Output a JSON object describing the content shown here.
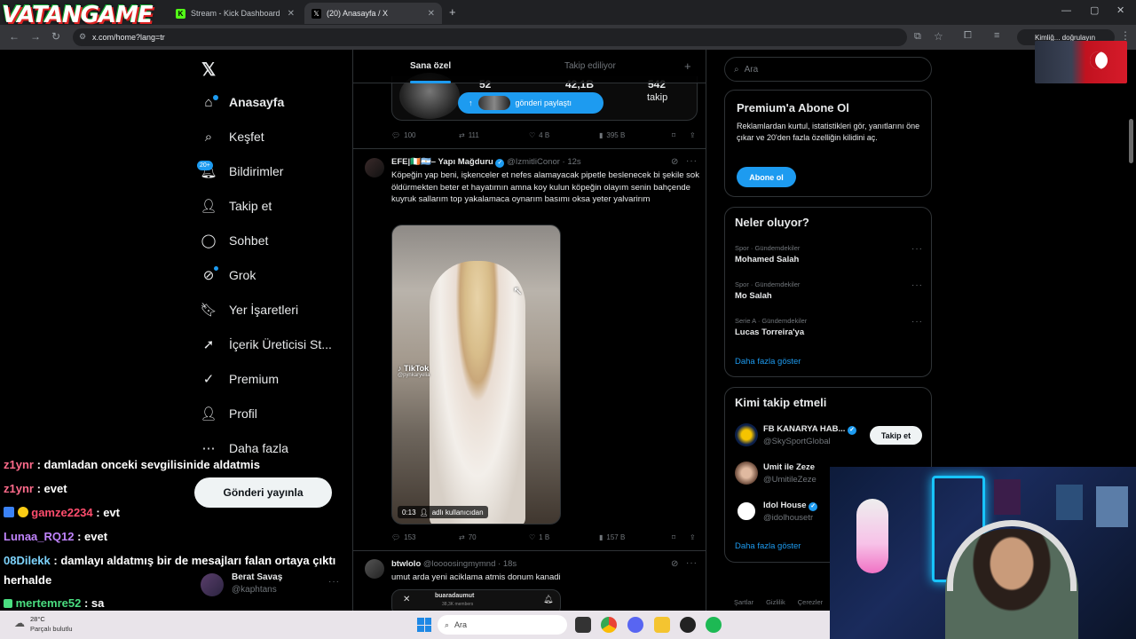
{
  "browser": {
    "tabs": [
      {
        "label": "Stream - Kick Dashboard"
      },
      {
        "label": "(20) Anasayfa / X"
      }
    ],
    "url": "x.com/home?lang=tr",
    "profile_label": "Kimliğ... doğrulayın",
    "watermark": "VATANGAME"
  },
  "sidebar": {
    "items": [
      {
        "label": "Anasayfa"
      },
      {
        "label": "Keşfet"
      },
      {
        "label": "Bildirimler",
        "badge": "20+"
      },
      {
        "label": "Takip et"
      },
      {
        "label": "Sohbet"
      },
      {
        "label": "Grok"
      },
      {
        "label": "Yer İşaretleri"
      },
      {
        "label": "İçerik Üreticisi St..."
      },
      {
        "label": "Premium"
      },
      {
        "label": "Profil"
      },
      {
        "label": "Daha fazla"
      }
    ],
    "post_button": "Gönderi yayınla",
    "account": {
      "name": "Berat Savaş",
      "handle": "@kaphtans"
    }
  },
  "feed": {
    "tabs": [
      "Sana özel",
      "Takip ediliyor"
    ],
    "embed": {
      "stat1": "52",
      "stat2": "42,1B",
      "stat3": "542",
      "stat3_label": "takip",
      "share": "gönderi paylaştı"
    },
    "post0_actions": {
      "replies": "100",
      "reposts": "111",
      "likes": "4 B",
      "views": "395 B"
    },
    "post1": {
      "name": "EFE|🇮🇪🇦🇷– Yapı Mağduru",
      "handle": "@IzmitliConor",
      "time": "12s",
      "text": "Köpeğin yap beni, işkenceler et nefes alamayacak pipetle beslenecek bi şekile sok öldürmekten beter et hayatımın amna koy kulun köpeğin olayım senin bahçende kuyruk sallarım top yakalamaca oynarım basımı oksa yeter yalvarirım",
      "video_time": "0:13",
      "video_caption": "adlı kullanıcıdan",
      "tiktok": "TikTok",
      "tiktok_user": "@pynkaryelia",
      "actions": {
        "replies": "153",
        "reposts": "70",
        "likes": "1 B",
        "views": "157 B"
      }
    },
    "post2": {
      "name": "btwlolo",
      "handle": "@loooosingmymnd",
      "time": "18s",
      "text": "umut arda yeni aciklama atmis donum kanadi",
      "embed_user": "buaradaumut",
      "embed_members": "38,3K members"
    }
  },
  "right": {
    "search_placeholder": "Ara",
    "premium": {
      "title": "Premium'a Abone Ol",
      "desc": "Reklamlardan kurtul, istatistikleri gör, yanıtlarını öne çıkar ve 20'den fazla özelliğin kilidini aç.",
      "button": "Abone ol"
    },
    "trends": {
      "title": "Neler oluyor?",
      "items": [
        {
          "meta": "Spor · Gündemdekiler",
          "name": "Mohamed Salah"
        },
        {
          "meta": "Spor · Gündemdekiler",
          "name": "Mo Salah"
        },
        {
          "meta": "Serie A · Gündemdekiler",
          "name": "Lucas Torreira'ya"
        }
      ],
      "more": "Daha fazla göster"
    },
    "follow": {
      "title": "Kimi takip etmeli",
      "items": [
        {
          "name": "FB KANARYA HAB...",
          "handle": "@SkySportGlobal",
          "button": "Takip et"
        },
        {
          "name": "Umit ile Zeze",
          "handle": "@UmitileZeze"
        },
        {
          "name": "Idol House",
          "handle": "@idolhousetr"
        }
      ],
      "more": "Daha fazla göster"
    },
    "footer": [
      "Şartlar",
      "Gizlilik",
      "Çerezler"
    ]
  },
  "chat": [
    {
      "user": "z1ynr",
      "msg": " : damladan onceki sevgilisinide aldatmis",
      "color": "#ff6b8b"
    },
    {
      "user": "z1ynr",
      "msg": " : evet",
      "color": "#ff6b8b"
    },
    {
      "user": "gamze2234",
      "msg": " : evt",
      "color": "#ff4d6d"
    },
    {
      "user": "Lunaa_RQ12",
      "msg": " : evet",
      "color": "#c084fc"
    },
    {
      "user": "08Dilekk",
      "msg": " : damlayı aldatmış bir de mesajları falan ortaya çıktı",
      "color": "#7dd3fc"
    },
    {
      "user": "",
      "msg": "herhalde",
      "color": "#fff"
    },
    {
      "user": "mertemre52",
      "msg": " : sa",
      "color": "#4ade80"
    }
  ],
  "taskbar": {
    "weather_temp": "28°C",
    "weather_desc": "Parçalı bulutlu",
    "search": "Ara"
  },
  "colors": {
    "accent": "#1d9bf0",
    "bg": "#000000",
    "border": "#2f3336"
  }
}
